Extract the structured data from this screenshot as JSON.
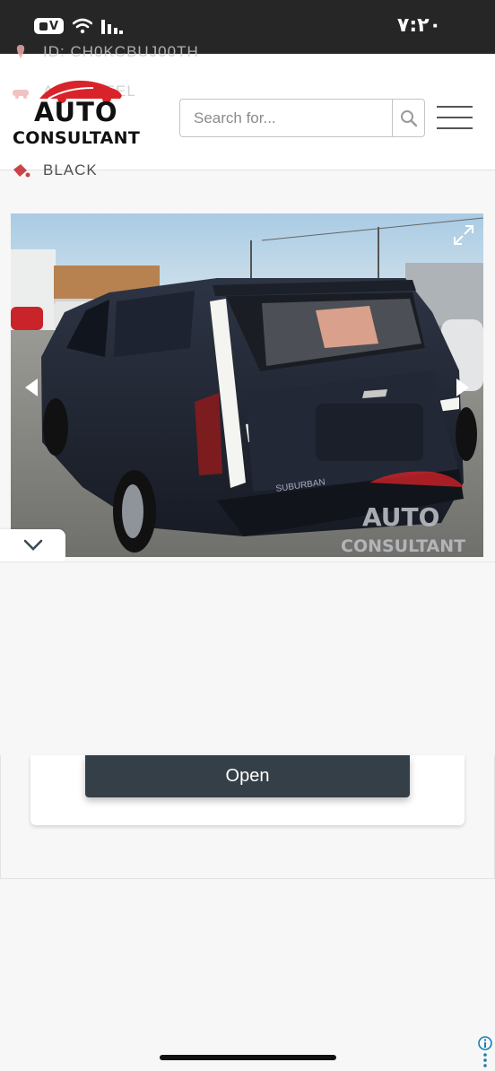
{
  "status_bar": {
    "vpn_label": "V",
    "time": "٧:٢٠"
  },
  "header": {
    "logo_line1": "AUTO",
    "logo_line2": "CONSULTANT",
    "ghost_row_1": "ID: CH0KCBUJ00TH",
    "ghost_row_2": "ALL WHEEL",
    "ghost_row_3": "BLACK",
    "search": {
      "placeholder": "Search for...",
      "value": ""
    },
    "icons": {
      "search": "search-icon",
      "menu": "hamburger-menu-icon"
    }
  },
  "gallery": {
    "image_alt_text": "",
    "watermark_line1": "AUTO",
    "watermark_line2": "CONSULTANT",
    "tailgate_text": "SUBURBAN",
    "icons": {
      "prev": "chevron-left-icon",
      "next": "chevron-right-icon",
      "expand": "expand-icon",
      "collapse": "chevron-down-icon"
    }
  },
  "card": {
    "open_label": "Open"
  },
  "colors": {
    "status_bar": "#262626",
    "button": "#343f47",
    "brand_red": "#d9232a"
  }
}
